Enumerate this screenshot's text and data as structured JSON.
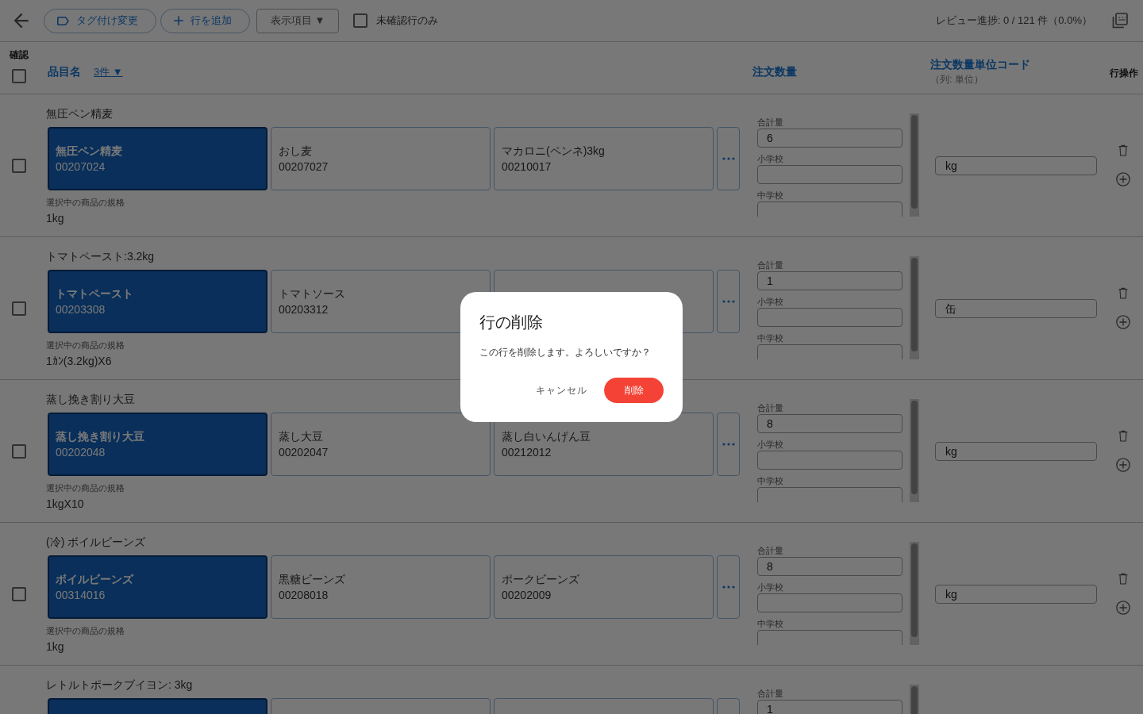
{
  "toolbar": {
    "buttons": [
      {
        "kind": "tag",
        "label": "タグ付け変更"
      },
      {
        "kind": "add",
        "label": "行を追加"
      },
      {
        "kind": "menu",
        "label": "表示項目 ▼"
      }
    ],
    "filter": {
      "label": "未確認行のみ",
      "checked": false
    },
    "review_count": "レビュー進捗: 0 / 121 件（0.0%）"
  },
  "header": {
    "confirm": {
      "label": "確認",
      "checked": false
    },
    "item": {
      "label": "品目名",
      "link": "3件 ▼"
    },
    "quantity": "注文数量",
    "unit": {
      "label": "注文数量単位コード",
      "note": "（列: 単位）"
    },
    "actions": "行操作"
  },
  "rows": [
    {
      "title": "無圧ペン精麦",
      "checked": false,
      "candidates": [
        {
          "name": "無圧ペン精麦",
          "code": "00207024",
          "selected": true
        },
        {
          "name": "おし麦",
          "code": "00207027",
          "selected": false
        },
        {
          "name": "マカロニ(ペンネ)3kg",
          "code": "00210017",
          "selected": false
        }
      ],
      "spec_label": "選択中の商品の規格",
      "spec": "1kg",
      "quantities": [
        {
          "label": "合計量",
          "value": "6"
        },
        {
          "label": "小学校"
        },
        {
          "label": "中学校"
        }
      ],
      "unit": "kg"
    },
    {
      "title": "トマトペースト:3.2kg",
      "checked": false,
      "candidates": [
        {
          "name": "トマトペースト",
          "code": "00203308",
          "selected": true
        },
        {
          "name": "トマトソース",
          "code": "00203312",
          "selected": false
        },
        {
          "selected": false
        }
      ],
      "spec_label": "選択中の商品の規格",
      "spec": "1ｶﾝ(3.2kg)X6",
      "quantities": [
        {
          "label": "合計量",
          "value": "1"
        },
        {
          "label": "小学校"
        },
        {
          "label": "中学校"
        }
      ],
      "unit": "缶"
    },
    {
      "title": "蒸し挽き割り大豆",
      "checked": false,
      "candidates": [
        {
          "name": "蒸し挽き割り大豆",
          "code": "00202048",
          "selected": true
        },
        {
          "name": "蒸し大豆",
          "code": "00202047",
          "selected": false
        },
        {
          "name": "蒸し白いんげん豆",
          "code": "00212012",
          "selected": false
        }
      ],
      "spec_label": "選択中の商品の規格",
      "spec": "1kgX10",
      "quantities": [
        {
          "label": "合計量",
          "value": "8"
        },
        {
          "label": "小学校"
        },
        {
          "label": "中学校"
        }
      ],
      "unit": "kg"
    },
    {
      "title": "(冷) ボイルビーンズ",
      "checked": false,
      "candidates": [
        {
          "name": "ボイルビーンズ",
          "code": "00314016",
          "selected": true
        },
        {
          "name": "黒糖ビーンズ",
          "code": "00208018",
          "selected": false
        },
        {
          "name": "ポークビーンズ",
          "code": "00202009",
          "selected": false
        }
      ],
      "spec_label": "選択中の商品の規格",
      "spec": "1kg",
      "quantities": [
        {
          "label": "合計量",
          "value": "8"
        },
        {
          "label": "小学校"
        },
        {
          "label": "中学校"
        }
      ],
      "unit": "kg"
    },
    {
      "title": "レトルトポークブイヨン: 3kg",
      "candidates": [
        {
          "selected": true
        },
        {
          "selected": false
        },
        {
          "selected": false
        }
      ],
      "quantities": [
        {
          "label": "合計量",
          "value": "1"
        }
      ]
    }
  ],
  "dialog": {
    "title": "行の削除",
    "message": "この行を削除します。よろしいですか？",
    "buttons": [
      {
        "kind": "text",
        "label": "キャンセル"
      },
      {
        "kind": "danger",
        "label": "削除"
      }
    ]
  }
}
